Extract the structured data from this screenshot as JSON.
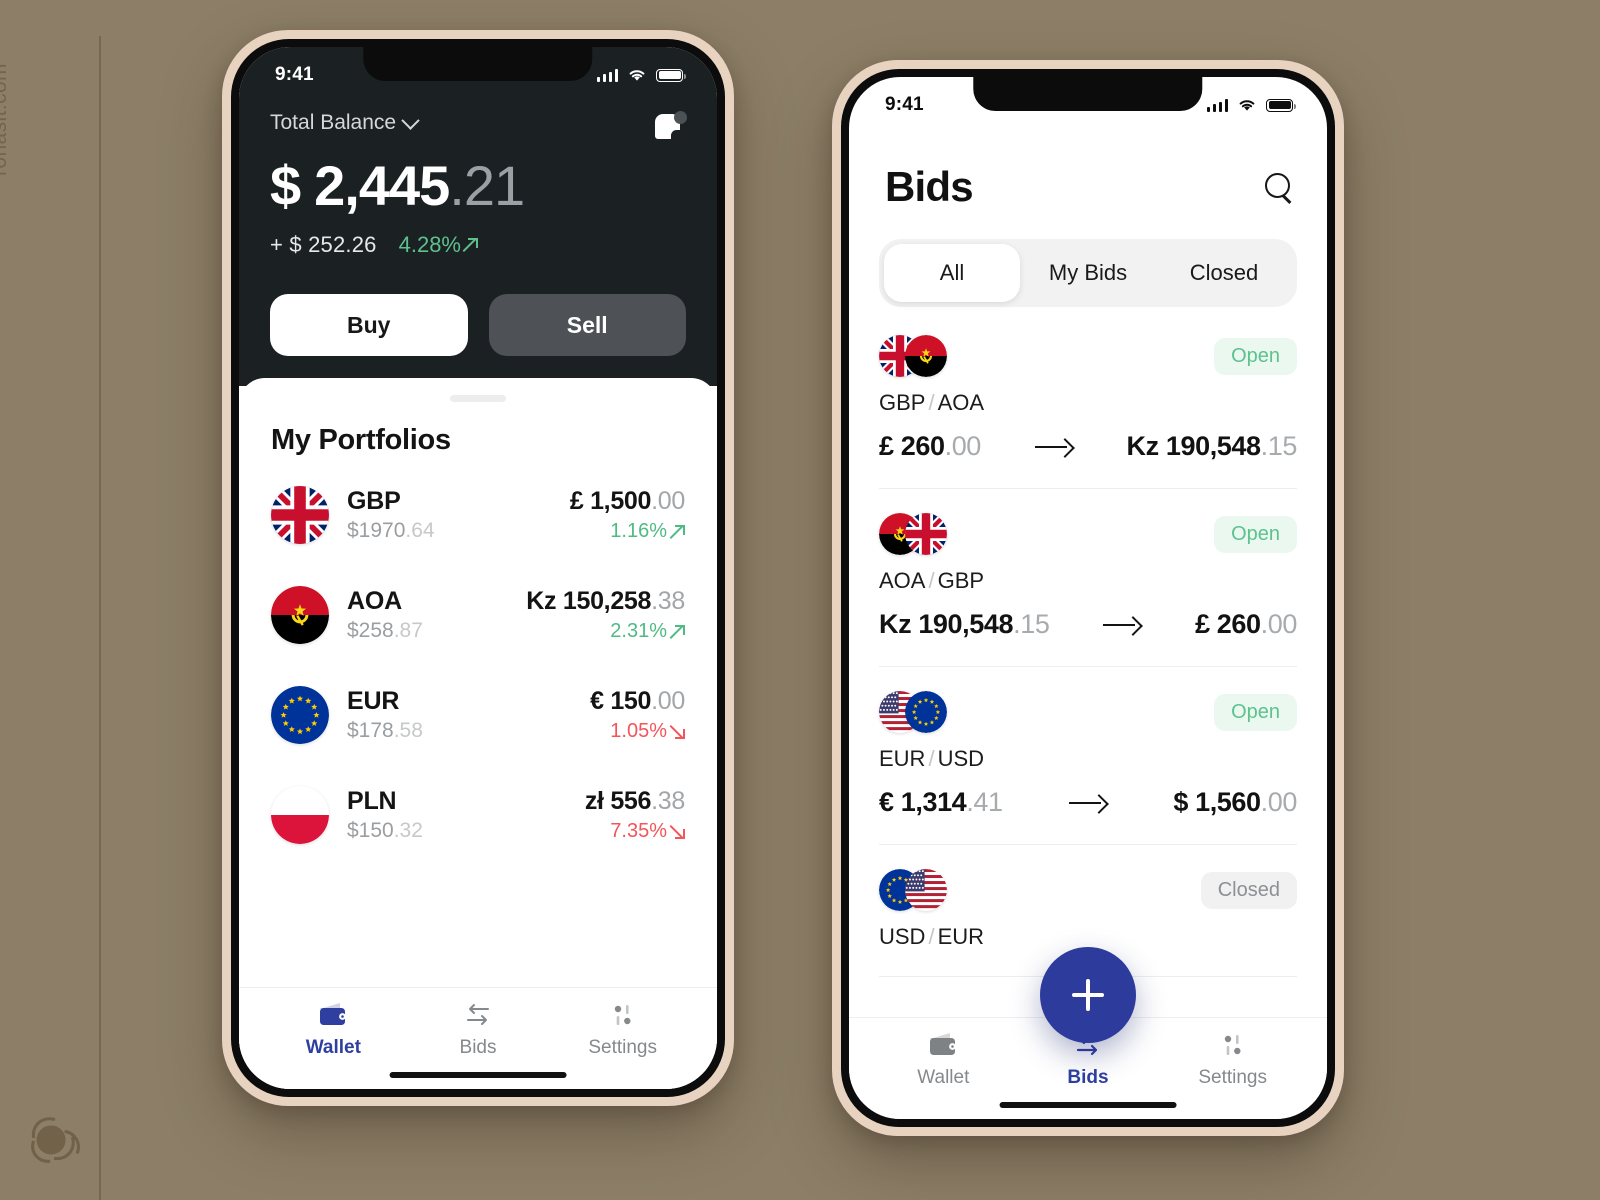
{
  "watermark": {
    "text": "ronasit.com"
  },
  "left_phone": {
    "status_bar": {
      "time": "9:41"
    },
    "header": {
      "balance_label": "Total Balance",
      "currency_symbol": "$",
      "amount_main": "2,445",
      "amount_cents": ".21",
      "delta": "+ $ 252.26",
      "percent": "4.28%",
      "percent_direction": "up",
      "buy_label": "Buy",
      "sell_label": "Sell"
    },
    "sheet": {
      "title": "My Portfolios",
      "portfolios": [
        {
          "code": "GBP",
          "flag": "gb",
          "usd_main": "$1970",
          "usd_cents": ".64",
          "value_symbol": "£",
          "value_main": "1,500",
          "value_cents": ".00",
          "pct": "1.16%",
          "dir": "up"
        },
        {
          "code": "AOA",
          "flag": "ao",
          "usd_main": "$258",
          "usd_cents": ".87",
          "value_symbol": "Kz",
          "value_main": "150,258",
          "value_cents": ".38",
          "pct": "2.31%",
          "dir": "up"
        },
        {
          "code": "EUR",
          "flag": "eu",
          "usd_main": "$178",
          "usd_cents": ".58",
          "value_symbol": "€",
          "value_main": "150",
          "value_cents": ".00",
          "pct": "1.05%",
          "dir": "down"
        },
        {
          "code": "PLN",
          "flag": "pl",
          "usd_main": "$150",
          "usd_cents": ".32",
          "value_symbol": "zł",
          "value_main": "556",
          "value_cents": ".38",
          "pct": "7.35%",
          "dir": "down"
        }
      ]
    },
    "tabbar": {
      "active": "wallet",
      "items": [
        {
          "id": "wallet",
          "label": "Wallet",
          "icon": "wallet-icon"
        },
        {
          "id": "bids",
          "label": "Bids",
          "icon": "exchange-arrows-icon"
        },
        {
          "id": "settings",
          "label": "Settings",
          "icon": "sliders-icon"
        }
      ]
    }
  },
  "right_phone": {
    "status_bar": {
      "time": "9:41"
    },
    "header": {
      "title": "Bids",
      "search_icon": "search-icon"
    },
    "segments": {
      "active": "All",
      "items": [
        "All",
        "My Bids",
        "Closed"
      ]
    },
    "bids": [
      {
        "flag_from": "gb",
        "flag_to": "ao",
        "from_code": "GBP",
        "to_code": "AOA",
        "status": "Open",
        "status_kind": "open",
        "from_symbol": "£",
        "from_main": "260",
        "from_cents": ".00",
        "to_symbol": "Kz",
        "to_main": "190,548",
        "to_cents": ".15"
      },
      {
        "flag_from": "ao",
        "flag_to": "gb",
        "from_code": "AOA",
        "to_code": "GBP",
        "status": "Open",
        "status_kind": "open",
        "from_symbol": "Kz",
        "from_main": "190,548",
        "from_cents": ".15",
        "to_symbol": "£",
        "to_main": "260",
        "to_cents": ".00"
      },
      {
        "flag_from": "us",
        "flag_to": "eu",
        "from_code": "EUR",
        "to_code": "USD",
        "status": "Open",
        "status_kind": "open",
        "from_symbol": "€",
        "from_main": "1,314",
        "from_cents": ".41",
        "to_symbol": "$",
        "to_main": "1,560",
        "to_cents": ".00"
      },
      {
        "flag_from": "eu",
        "flag_to": "us",
        "from_code": "USD",
        "to_code": "EUR",
        "status": "Closed",
        "status_kind": "closed",
        "from_symbol": "",
        "from_main": "",
        "from_cents": "",
        "to_symbol": "",
        "to_main": "",
        "to_cents": ""
      }
    ],
    "fab": {
      "label": "+",
      "icon": "plus-icon"
    },
    "tabbar": {
      "active": "bids",
      "items": [
        {
          "id": "wallet",
          "label": "Wallet",
          "icon": "wallet-icon"
        },
        {
          "id": "bids",
          "label": "Bids",
          "icon": "exchange-arrows-icon"
        },
        {
          "id": "settings",
          "label": "Settings",
          "icon": "sliders-icon"
        }
      ]
    }
  },
  "colors": {
    "background": "#8d7f67",
    "phone_frame": "#e8d3c0",
    "dark_panel": "#1b2023",
    "accent": "#2c3b9c",
    "positive": "#4fba84",
    "negative": "#f2555a"
  }
}
